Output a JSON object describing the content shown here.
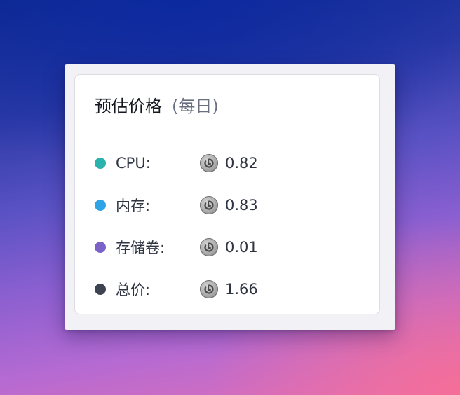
{
  "header": {
    "title": "预估价格",
    "subtitle": "(每日)"
  },
  "rows": [
    {
      "label": "CPU:",
      "value": "0.82",
      "dot_color": "#2ab3ad",
      "icon": "coin-icon"
    },
    {
      "label": "内存:",
      "value": "0.83",
      "dot_color": "#2ea3e6",
      "icon": "coin-icon"
    },
    {
      "label": "存储卷:",
      "value": "0.01",
      "dot_color": "#7a62c9",
      "icon": "coin-icon"
    },
    {
      "label": "总价:",
      "value": "1.66",
      "dot_color": "#3d4350",
      "icon": "coin-icon"
    }
  ]
}
